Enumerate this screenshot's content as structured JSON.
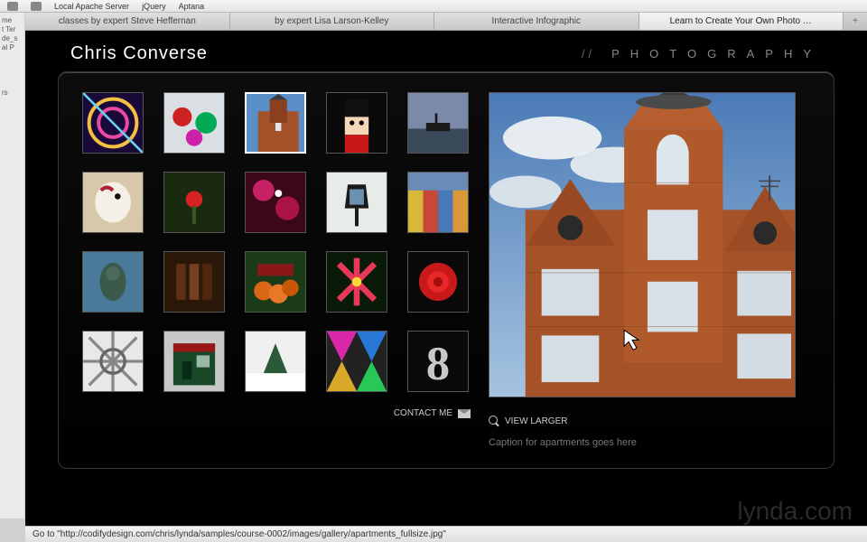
{
  "menubar": {
    "items": [
      "Local Apache Server",
      "jQuery",
      "Aptana"
    ]
  },
  "sidebar_sliver": [
    "me",
    "t Ter",
    "de_s",
    "al P",
    "",
    "rs"
  ],
  "tabs": [
    {
      "label": "classes by expert Steve Heffernan",
      "active": false
    },
    {
      "label": "by expert Lisa Larson-Kelley",
      "active": false
    },
    {
      "label": "Interactive Infographic",
      "active": false
    },
    {
      "label": "Learn to Create Your Own Photo …",
      "active": true
    }
  ],
  "header": {
    "brand": "Chris Converse",
    "subtitle_prefix": "//",
    "subtitle": "PHOTOGRAPHY"
  },
  "gallery": {
    "selected_index": 2,
    "thumbs": [
      {
        "name": "spiral-lights"
      },
      {
        "name": "ornaments"
      },
      {
        "name": "apartments"
      },
      {
        "name": "nutcracker"
      },
      {
        "name": "ship-sunset"
      },
      {
        "name": "carousel-horse"
      },
      {
        "name": "rose-hip"
      },
      {
        "name": "stage-lights"
      },
      {
        "name": "street-lamp"
      },
      {
        "name": "row-houses"
      },
      {
        "name": "statue"
      },
      {
        "name": "glass-bottles"
      },
      {
        "name": "pumpkins"
      },
      {
        "name": "lily"
      },
      {
        "name": "red-rose"
      },
      {
        "name": "metal-structure"
      },
      {
        "name": "storefront"
      },
      {
        "name": "snow-pine"
      },
      {
        "name": "quilt-pattern"
      },
      {
        "name": "number-eight"
      }
    ]
  },
  "actions": {
    "contact_label": "CONTACT ME",
    "view_larger_label": "VIEW LARGER"
  },
  "caption": "Caption for apartments goes here",
  "status_text": "Go to \"http://codifydesign.com/chris/lynda/samples/course-0002/images/gallery/apartments_fullsize.jpg\"",
  "watermark": "lynda.com"
}
